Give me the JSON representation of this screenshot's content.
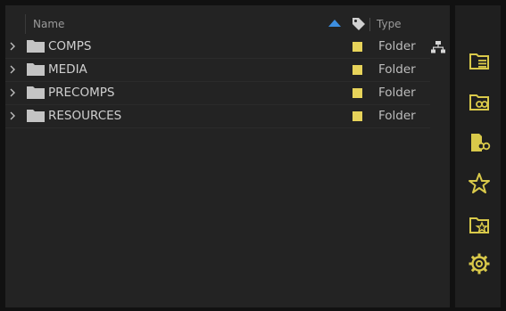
{
  "header": {
    "name_label": "Name",
    "type_label": "Type"
  },
  "rows": [
    {
      "label": "COMPS",
      "type": "Folder",
      "label_color": "#e7d35a"
    },
    {
      "label": "MEDIA",
      "type": "Folder",
      "label_color": "#e7d35a"
    },
    {
      "label": "PRECOMPS",
      "type": "Folder",
      "label_color": "#e7d35a"
    },
    {
      "label": "RESOURCES",
      "type": "Folder",
      "label_color": "#e7d35a"
    }
  ],
  "sidebar": {
    "icons": [
      "folder-list-icon",
      "folder-search-icon",
      "file-search-icon",
      "star-icon",
      "folder-star-icon",
      "gear-icon"
    ]
  },
  "colors": {
    "accent_blue": "#3d8fe0",
    "icon_yellow": "#d9c94a",
    "label_yellow": "#e7d35a"
  }
}
